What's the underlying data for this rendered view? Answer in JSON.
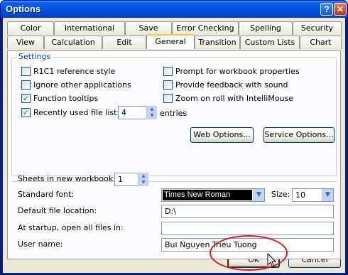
{
  "window": {
    "title": "Options"
  },
  "tabs_row1": [
    "Color",
    "International",
    "Save",
    "Error Checking",
    "Spelling",
    "Security"
  ],
  "tabs_row2": [
    "View",
    "Calculation",
    "Edit",
    "General",
    "Transition",
    "Custom Lists",
    "Chart"
  ],
  "active_tab": "General",
  "settings": {
    "group_title": "Settings",
    "r1c1": {
      "label": "R1C1 reference style",
      "checked": false
    },
    "ignore_apps": {
      "label": "Ignore other applications",
      "checked": false
    },
    "function_tooltips": {
      "label": "Function tooltips",
      "checked": true
    },
    "recent_files": {
      "label": "Recently used file list:",
      "checked": true,
      "count": "4",
      "suffix": "entries"
    },
    "prompt_props": {
      "label": "Prompt for workbook properties",
      "checked": false
    },
    "feedback_sound": {
      "label": "Provide feedback with sound",
      "checked": false
    },
    "zoom_roll": {
      "label": "Zoom on roll with IntelliMouse",
      "checked": false
    },
    "web_options_label": "Web Options...",
    "service_options_label": "Service Options..."
  },
  "sheets": {
    "label": "Sheets in new workbook:",
    "value": "1"
  },
  "font": {
    "label": "Standard font:",
    "value": "Times New Roman",
    "size_label": "Size:",
    "size_value": "10"
  },
  "default_location": {
    "label": "Default file location:",
    "value": "D:\\"
  },
  "startup": {
    "label": "At startup, open all files in:",
    "value": ""
  },
  "user_name": {
    "label": "User name:",
    "value": "Bui Nguyen Trieu Tuong"
  },
  "buttons": {
    "ok": "OK",
    "cancel": "Cancel"
  },
  "colors": {
    "accent": "#0046d5",
    "tab_highlight": "#ffc83c",
    "annotation": "#e0181a"
  }
}
